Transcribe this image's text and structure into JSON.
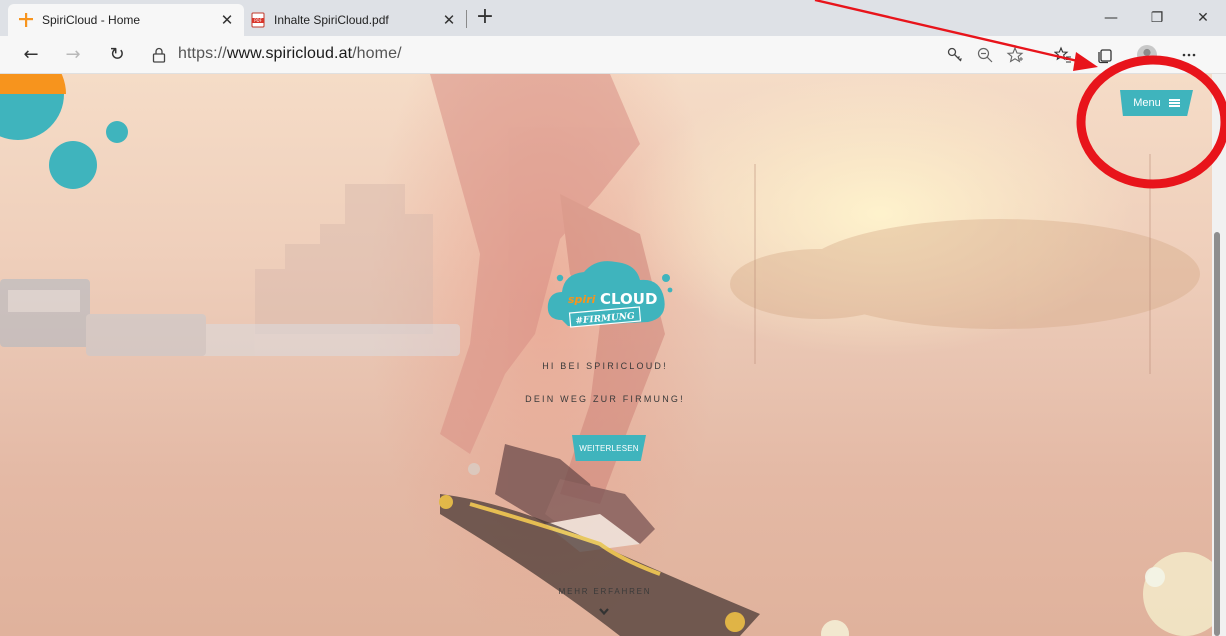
{
  "browser": {
    "tabs": [
      {
        "title": "SpiriCloud - Home",
        "favicon": "spiricloud-cross-icon",
        "active": true,
        "close_glyph": "✕"
      },
      {
        "title": "Inhalte SpiriCloud.pdf",
        "favicon": "pdf-file-icon",
        "active": false,
        "close_glyph": "✕"
      }
    ],
    "new_tab_glyph": "+",
    "window_controls": {
      "minimize": "—",
      "restore": "❐",
      "close": "✕"
    },
    "nav": {
      "back": "←",
      "forward": "→",
      "refresh": "↻"
    },
    "address": {
      "scheme": "https://",
      "host": "www.spiricloud.at",
      "path": "/home/"
    },
    "toolbar_icons": [
      "key-icon",
      "zoom-out-icon",
      "favorite-star-icon",
      "favorites-list-icon",
      "collections-icon",
      "profile-avatar-icon",
      "more-icon"
    ]
  },
  "page": {
    "menu": {
      "label": "Menu",
      "icon": "hamburger-icon"
    },
    "logo": {
      "brand_left": "spiri",
      "brand_right": "CLOUD",
      "tag": "#FIRMUNG"
    },
    "hero": {
      "greeting": "HI BEI SPIRICLOUD!",
      "tagline": "DEIN WEG ZUR FIRMUNG!",
      "cta_label": "WEITERLESEN",
      "more_label": "MEHR ERFAHREN"
    },
    "colors": {
      "brand_teal": "#3fb4bd",
      "brand_orange": "#f7941d",
      "annotation_red": "#e8141b",
      "cloud_green": "#a8d85a"
    }
  },
  "annotation": {
    "type": "red-arrow-and-circle",
    "target": "menu-button"
  }
}
